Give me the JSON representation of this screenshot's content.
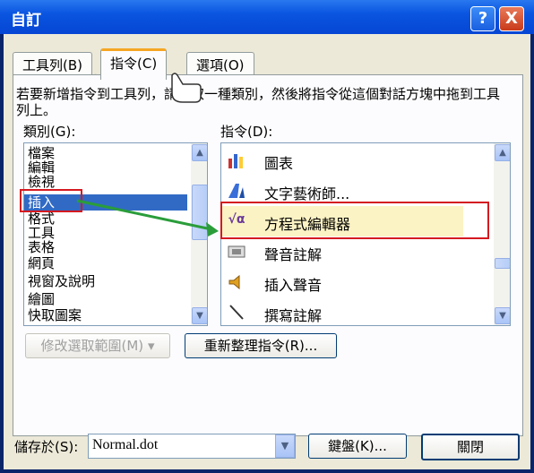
{
  "window": {
    "title": "自訂",
    "help_btn": "?",
    "close_btn": "X"
  },
  "tabs": [
    {
      "label": "工具列(B)",
      "active": false
    },
    {
      "label": "指令(C)",
      "active": true
    },
    {
      "label": "選項(O)",
      "active": false
    }
  ],
  "description": "若要新增指令到工具列，請選取一種類別，然後將指令從這個對話方塊中拖到工具列上。",
  "categories": {
    "label": "類別(G):",
    "items": [
      "檔案",
      "編輯",
      "檢視",
      "插入",
      "格式",
      "工具",
      "表格",
      "網頁",
      "視窗及說明",
      "繪圖",
      "快取圖案"
    ],
    "selected": "插入"
  },
  "commands": {
    "label": "指令(D):",
    "items": [
      {
        "icon": "chart-icon",
        "label": "圖表"
      },
      {
        "icon": "wordart-icon",
        "label": "文字藝術師..."
      },
      {
        "icon": "equation-icon",
        "label": "方程式編輯器"
      },
      {
        "icon": "sound-icon",
        "label": "聲音註解"
      },
      {
        "icon": "insert-sound-icon",
        "label": "插入聲音"
      },
      {
        "icon": "pen-icon",
        "label": "撰寫註解"
      }
    ]
  },
  "buttons": {
    "modify_selection": "修改選取範圍(M)",
    "rearrange": "重新整理指令(R)...",
    "keyboard": "鍵盤(K)...",
    "close": "關閉"
  },
  "save_in": {
    "label": "儲存於(S):",
    "value": "Normal.dot"
  },
  "colors": {
    "highlight": "#d51a20",
    "arrow": "#2a9d3a",
    "selected": "#316ac5"
  }
}
